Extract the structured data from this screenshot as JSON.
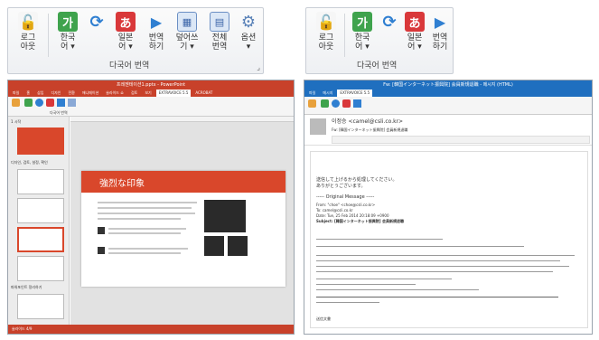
{
  "ribbon_full": {
    "buttons": [
      {
        "label": "로그\n아웃",
        "icon": "lock-icon"
      },
      {
        "label": "한국\n어 ▾",
        "icon": "hangul-ga-icon"
      },
      {
        "label": "",
        "icon": "refresh-icon"
      },
      {
        "label": "일본\n어 ▾",
        "icon": "hiragana-a-icon"
      },
      {
        "label": "번역\n하기",
        "icon": "play-icon"
      },
      {
        "label": "덮어쓰\n기 ▾",
        "icon": "document-grid-icon"
      },
      {
        "label": "전체\n번역",
        "icon": "window-icon"
      },
      {
        "label": "옵션\n▾",
        "icon": "gear-icon"
      }
    ],
    "group_label": "다국어 번역",
    "launcher": "⌟"
  },
  "ribbon_compact": {
    "buttons": [
      {
        "label": "로그\n아웃",
        "icon": "lock-icon"
      },
      {
        "label": "한국\n어 ▾",
        "icon": "hangul-ga-icon"
      },
      {
        "label": "",
        "icon": "refresh-icon"
      },
      {
        "label": "일본\n어 ▾",
        "icon": "hiragana-a-icon"
      },
      {
        "label": "번역\n하기",
        "icon": "play-icon"
      }
    ],
    "group_label": "다국어 번역"
  },
  "powerpoint": {
    "title": "프레젠테이션1.pptx - PowerPoint",
    "tabs": [
      "파일",
      "홈",
      "삽입",
      "디자인",
      "전환",
      "애니메이션",
      "슬라이드 쇼",
      "검토",
      "보기",
      "EXTRAVOICE 5.5",
      "ACROBAT"
    ],
    "active_tab": "EXTRAVOICE 5.5",
    "group_label": "다국어 번역",
    "sections": [
      "1 시작",
      "디자인, 검토, 설정, 확인",
      "파워포인트 정리하기"
    ],
    "slide_title": "強烈な印象",
    "statusbar": "슬라이드 4/9"
  },
  "outlook": {
    "title": "Fw: [韓国インターネット振興院] 会員新規退職 - 메시지 (HTML)",
    "tabs": [
      "파일",
      "메시지",
      "EXTRAVOICE 5.5"
    ],
    "active_tab": "EXTRAVOICE 5.5",
    "sender": "이정승 <camel@csli.co.kr>",
    "subject": "Fw: [韓国インターネット振興院] 会員新規退職",
    "greeting": "送信して上げるから処理してください。\nありがとうございます。",
    "original": "----- Original Message -----",
    "from": "From: \"choe\" <choe@csli.co.kr>",
    "to": "To: camel@csli.co.kr",
    "date": "Date: Tue, 25 Feb 2014 20:18:09 +0900",
    "subj2": "Subject: [韓国インターネット振興院] 会員新規退職",
    "footer": "送信文書"
  }
}
